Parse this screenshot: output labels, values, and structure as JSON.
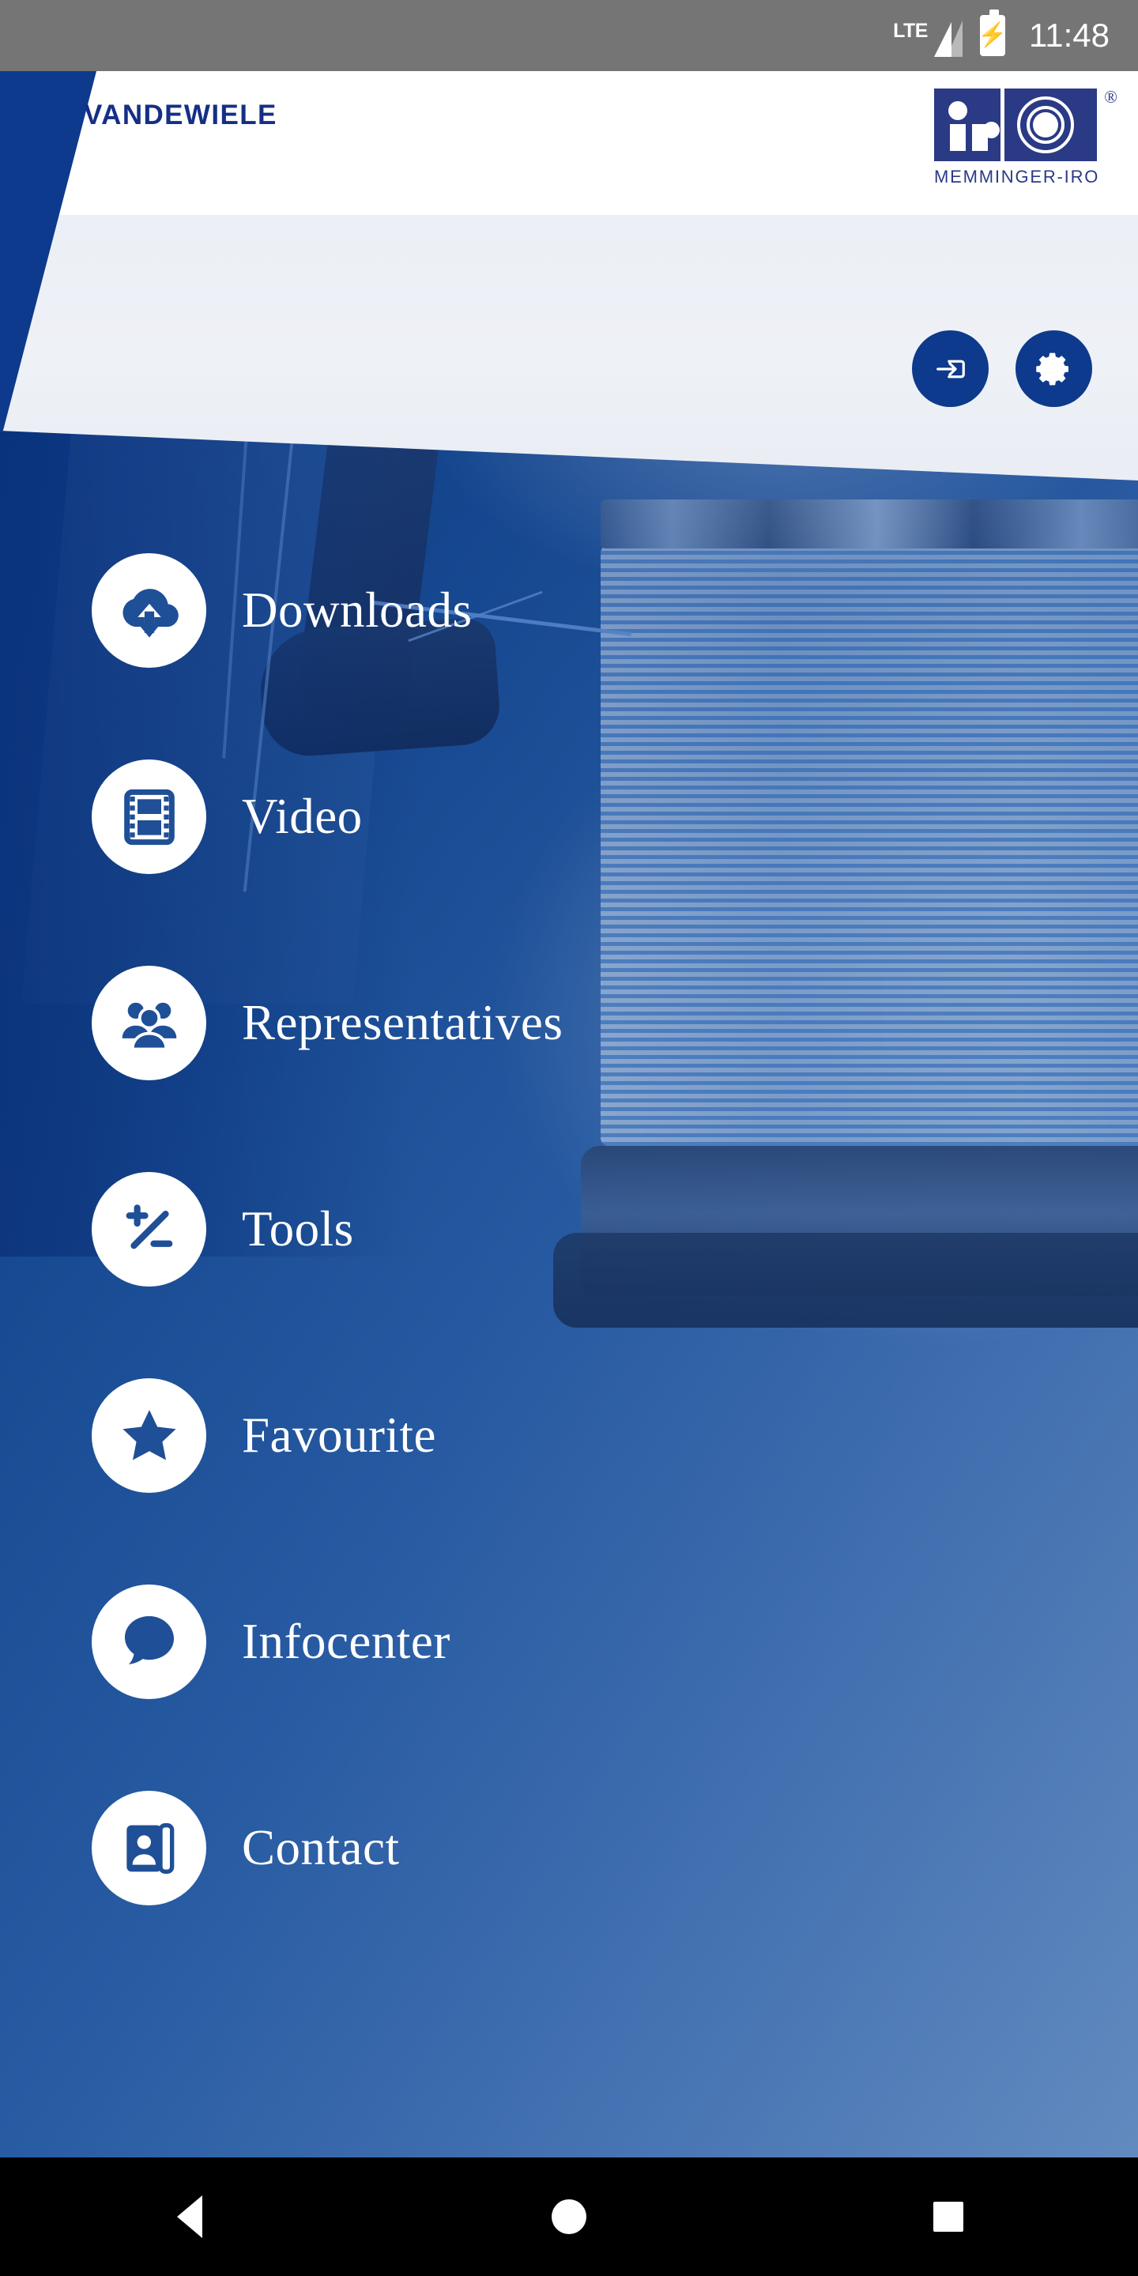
{
  "status_bar": {
    "network_label": "LTE",
    "signal_icon": "signal-bars-icon",
    "battery_icon": "battery-charging-icon",
    "time": "11:48"
  },
  "header": {
    "brand_logo_text": "VANDEWIELE",
    "brand_logo_icon": "vandewiele-diamond-icon",
    "product_logo_text": "MEMMINGER-IRO",
    "product_logo_mark": "iro-logo-mark",
    "product_logo_registered": "®",
    "actions": [
      {
        "name": "login-button",
        "icon": "login-arrow-icon",
        "label": "Login"
      },
      {
        "name": "settings-button",
        "icon": "gear-icon",
        "label": "Settings"
      }
    ]
  },
  "menu": {
    "items": [
      {
        "label": "Downloads",
        "icon": "cloud-download-icon"
      },
      {
        "label": "Video",
        "icon": "film-strip-icon"
      },
      {
        "label": "Representatives",
        "icon": "people-group-icon"
      },
      {
        "label": "Tools",
        "icon": "plus-minus-icon"
      },
      {
        "label": "Favourite",
        "icon": "star-icon"
      },
      {
        "label": "Infocenter",
        "icon": "speech-bubble-icon"
      },
      {
        "label": "Contact",
        "icon": "contact-card-icon"
      }
    ]
  },
  "navigation_bar": {
    "buttons": [
      {
        "name": "nav-back-button",
        "icon": "triangle-back-icon"
      },
      {
        "name": "nav-home-button",
        "icon": "circle-home-icon"
      },
      {
        "name": "nav-recents-button",
        "icon": "square-recents-icon"
      }
    ]
  },
  "colors": {
    "brand_navy": "#0d3a8c",
    "logo_navy": "#152f86",
    "miro_navy": "#2b3a85",
    "status_bar_gray": "#757575",
    "panel_white": "#ffffff",
    "panel_gray": "#eceff5",
    "nav_black": "#000000"
  }
}
